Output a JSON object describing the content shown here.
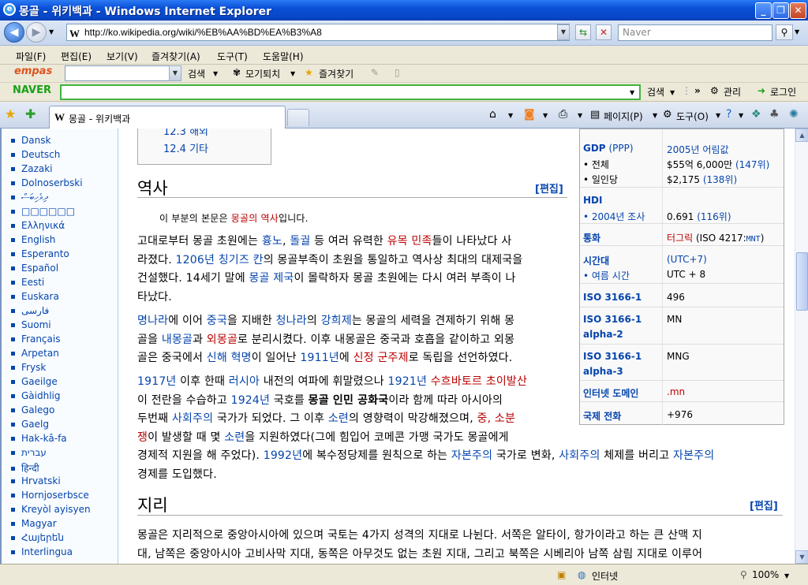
{
  "window": {
    "title": "몽골 - 위키백과 - Windows Internet Explorer"
  },
  "nav": {
    "url": "http://ko.wikipedia.org/wiki/%EB%AA%BD%EA%B3%A8",
    "search_placeholder": "Naver"
  },
  "menu": [
    "파일(F)",
    "편집(E)",
    "보기(V)",
    "즐겨찾기(A)",
    "도구(T)",
    "도움말(H)"
  ],
  "empas": {
    "logo": "empas",
    "search": "검색",
    "item1": "모기퇴치",
    "item2": "즐겨찾기"
  },
  "naver": {
    "logo": "NAVER",
    "search": "검색",
    "manage": "관리",
    "login": "로그인"
  },
  "tab": {
    "label": "몽골 - 위키백과"
  },
  "commands": {
    "page": "페이지(P)",
    "tools": "도구(O)"
  },
  "sidebar": {
    "languages": [
      "Dansk",
      "Deutsch",
      "Zazaki",
      "Dolnoserbski",
      "ދިވެހިބަސް",
      "□□□□□□",
      "Ελληνικά",
      "English",
      "Esperanto",
      "Español",
      "Eesti",
      "Euskara",
      "فارسی",
      "Suomi",
      "Français",
      "Arpetan",
      "Frysk",
      "Gaeilge",
      "Gàidhlig",
      "Galego",
      "Gaelg",
      "Hak-kâ-fa",
      "עברית",
      "हिन्दी",
      "Hrvatski",
      "Hornjoserbsce",
      "Kreyòl ayisyen",
      "Magyar",
      "Հայերեն",
      "Interlingua"
    ]
  },
  "toc": {
    "item1": "12.3 해외",
    "item2": "12.4 기타"
  },
  "history": {
    "heading": "역사",
    "edit": "[편집]",
    "main_note_pre": "이 부분의 본문은 ",
    "main_note_link": "몽골의 역사",
    "main_note_post": "입니다.",
    "p1": [
      [
        "고대로부터 몽골 초원에는 ",
        "",
        "흉노",
        "link",
        ", ",
        "",
        "돌궐",
        "link",
        " 등 여러 유력한 ",
        "",
        "유목 민족",
        "red",
        "들이 나타났다 사"
      ],
      [
        "라졌다. ",
        "",
        "1206년",
        "link",
        " ",
        "",
        "칭기즈 칸",
        "link",
        "의 몽골부족이 초원을 통일하고 역사상 최대의 대제국을"
      ],
      [
        "건설했다. 14세기 말에 ",
        "",
        "몽골 제국",
        "link",
        "이 몰락하자 몽골 초원에는 다시 여러 부족이 나"
      ],
      [
        "타났다.",
        ""
      ]
    ],
    "p2": [
      [
        "명나라",
        "link",
        "에 이어 ",
        "",
        "중국",
        "link",
        "을 지배한 ",
        "",
        "청나라",
        "link",
        "의 ",
        "",
        "강희제",
        "link",
        "는 몽골의 세력을 견제하기 위해 몽"
      ],
      [
        "골을 ",
        "",
        "내몽골",
        "link",
        "과 ",
        "",
        "외몽골",
        "red",
        "로 분리시켰다. 이후 내몽골은 중국과 호흡을 같이하고 외몽"
      ],
      [
        "골은 중국에서 ",
        "",
        "신해 혁명",
        "link",
        "이 일어난 ",
        "",
        "1911년",
        "link",
        "에 ",
        "",
        "신정 군주제",
        "red",
        "로 독립을 선언하였다."
      ]
    ],
    "p3": [
      [
        "1917년",
        "link",
        " 이후 한때 ",
        "",
        "러시아",
        "link",
        " 내전의 여파에 휘말렸으나 ",
        "",
        "1921년",
        "link",
        " ",
        "",
        "수흐바토르 초이발산",
        "red"
      ],
      [
        "이 전란을 수습하고 ",
        "",
        "1924년",
        "link",
        " 국호를 ",
        "",
        "몽골 인민 공화국",
        "bold",
        "이라 함께 따라 아시아의"
      ],
      [
        "두번째 ",
        "",
        "사회주의",
        "link",
        " 국가가 되었다. 그 이후 ",
        "",
        "소련",
        "link",
        "의 영향력이 막강해졌으며, ",
        "",
        "중, 소분",
        "red"
      ],
      [
        "쟁",
        "red",
        "이 발생할 때 몇 ",
        "",
        "소련",
        "link",
        "을 지원하였다(그에 힘입어 코메콘 가맹 국가도 몽골에게"
      ],
      [
        "경제적 지원을 해 주었다). ",
        "",
        "1992년",
        "link",
        "에 복수정당제를 원칙으로 하는 ",
        "",
        "자본주의",
        "link",
        " 국가로 변화, ",
        "",
        "사회주의",
        "link",
        " 체제를 버리고 ",
        "",
        "자본주의",
        "link"
      ],
      [
        "경제를 도입했다.",
        ""
      ]
    ]
  },
  "geography": {
    "heading": "지리",
    "edit": "[편집]",
    "p1": [
      [
        "몽골은 지리적으로 중앙아시아에 있으며 국토는 4가지 성격의 지대로 나뉜다. 서쪽은 알타이, 항가이라고 하는 큰 산맥 지",
        ""
      ],
      [
        "대, 남쪽은 중앙아시아 고비사막 지대, 동쪽은 아무것도 없는 초원 지대, 그리고 북쪽은 시베리아 남쪽 삼림 지대로 이루어",
        ""
      ]
    ]
  },
  "infobox": {
    "gdp_label": "GDP",
    "gdp_ppp": "(PPP)",
    "gdp_year": "2005년 어림값",
    "gdp_total_label": "• 전체",
    "gdp_total_value": "$55억 6,000만",
    "gdp_total_rank": "(147위)",
    "gdp_pc_label": "• 일인당",
    "gdp_pc_value": "$2,175",
    "gdp_pc_rank": "(138위)",
    "hdi_label": "HDI",
    "hdi_year_label": "• 2004년 조사",
    "hdi_value": "0.691",
    "hdi_rank": "(116위)",
    "currency_label": "통화",
    "currency_value": "터그릭",
    "currency_iso": "(ISO 4217:",
    "currency_code": "MNT",
    "currency_close": ")",
    "tz_label": "시간대",
    "tz_value": "(UTC+7)",
    "dst_label": "• 여름 시간",
    "dst_value": "UTC + 8",
    "iso1_label": "ISO 3166-1",
    "iso1_value": "496",
    "iso2_label1": "ISO 3166-1",
    "iso2_label2": "alpha-2",
    "iso2_value": "MN",
    "iso3_label1": "ISO 3166-1",
    "iso3_label2": "alpha-3",
    "iso3_value": "MNG",
    "tld_label": "인터넷 도메인",
    "tld_value": ".mn",
    "phone_label": "국제 전화",
    "phone_value": "+976"
  },
  "status": {
    "zone": "인터넷",
    "zoom": "100%"
  }
}
